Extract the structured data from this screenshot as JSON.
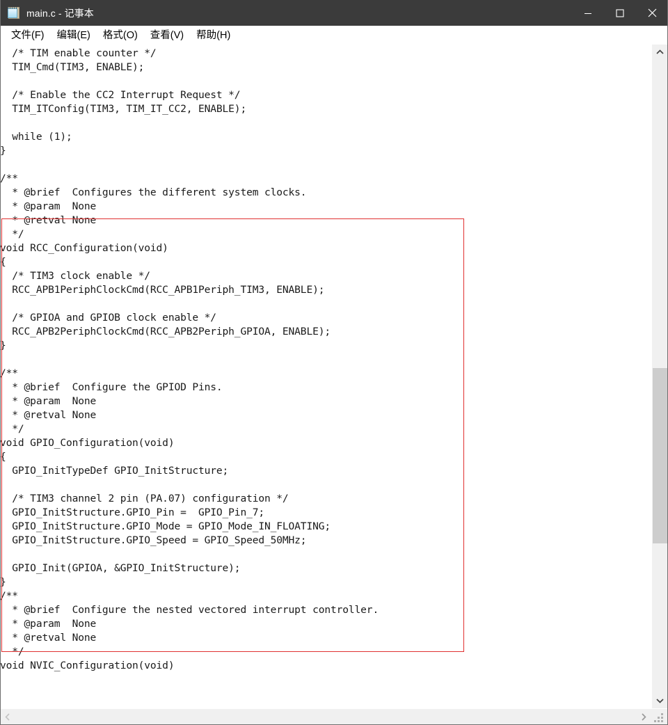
{
  "window": {
    "title": "main.c - 记事本",
    "icon": "notepad-icon"
  },
  "titlebar_buttons": {
    "minimize": "minimize-icon",
    "maximize": "maximize-icon",
    "close": "close-icon"
  },
  "menubar": {
    "items": [
      {
        "label": "文件(F)"
      },
      {
        "label": "编辑(E)"
      },
      {
        "label": "格式(O)"
      },
      {
        "label": "查看(V)"
      },
      {
        "label": "帮助(H)"
      }
    ]
  },
  "editor": {
    "text": "  /* TIM enable counter */\n  TIM_Cmd(TIM3, ENABLE);\n\n  /* Enable the CC2 Interrupt Request */\n  TIM_ITConfig(TIM3, TIM_IT_CC2, ENABLE);\n\n  while (1);\n}\n\n/**\n  * @brief  Configures the different system clocks.\n  * @param  None\n  * @retval None\n  */\nvoid RCC_Configuration(void)\n{\n  /* TIM3 clock enable */\n  RCC_APB1PeriphClockCmd(RCC_APB1Periph_TIM3, ENABLE);\n\n  /* GPIOA and GPIOB clock enable */\n  RCC_APB2PeriphClockCmd(RCC_APB2Periph_GPIOA, ENABLE);\n}\n\n/**\n  * @brief  Configure the GPIOD Pins.\n  * @param  None\n  * @retval None\n  */\nvoid GPIO_Configuration(void)\n{\n  GPIO_InitTypeDef GPIO_InitStructure;\n\n  /* TIM3 channel 2 pin (PA.07) configuration */\n  GPIO_InitStructure.GPIO_Pin =  GPIO_Pin_7;\n  GPIO_InitStructure.GPIO_Mode = GPIO_Mode_IN_FLOATING;\n  GPIO_InitStructure.GPIO_Speed = GPIO_Speed_50MHz;\n\n  GPIO_Init(GPIOA, &GPIO_InitStructure);\n}\n/**\n  * @brief  Configure the nested vectored interrupt controller.\n  * @param  None\n  * @retval None\n  */\nvoid NVIC_Configuration(void)"
  },
  "annotation": {
    "shape": "rectangle",
    "color": "#e03030",
    "encloses": "RCC_Configuration and GPIO_Configuration function blocks"
  },
  "scrollbars": {
    "vertical": {
      "up_arrow": "chevron-up-icon",
      "down_arrow": "chevron-down-icon",
      "thumb_color": "#cdcdcd",
      "track_color": "#f0f0f0"
    },
    "horizontal": {
      "left_arrow": "chevron-left-icon",
      "right_arrow": "chevron-right-icon",
      "track_color": "#f0f0f0"
    },
    "resize_grip": "resize-grip-icon"
  },
  "colors": {
    "titlebar_bg": "#3b3b3b",
    "titlebar_fg": "#ffffff",
    "editor_bg": "#ffffff",
    "editor_fg": "#1a1a1a",
    "annotation": "#e03030"
  }
}
